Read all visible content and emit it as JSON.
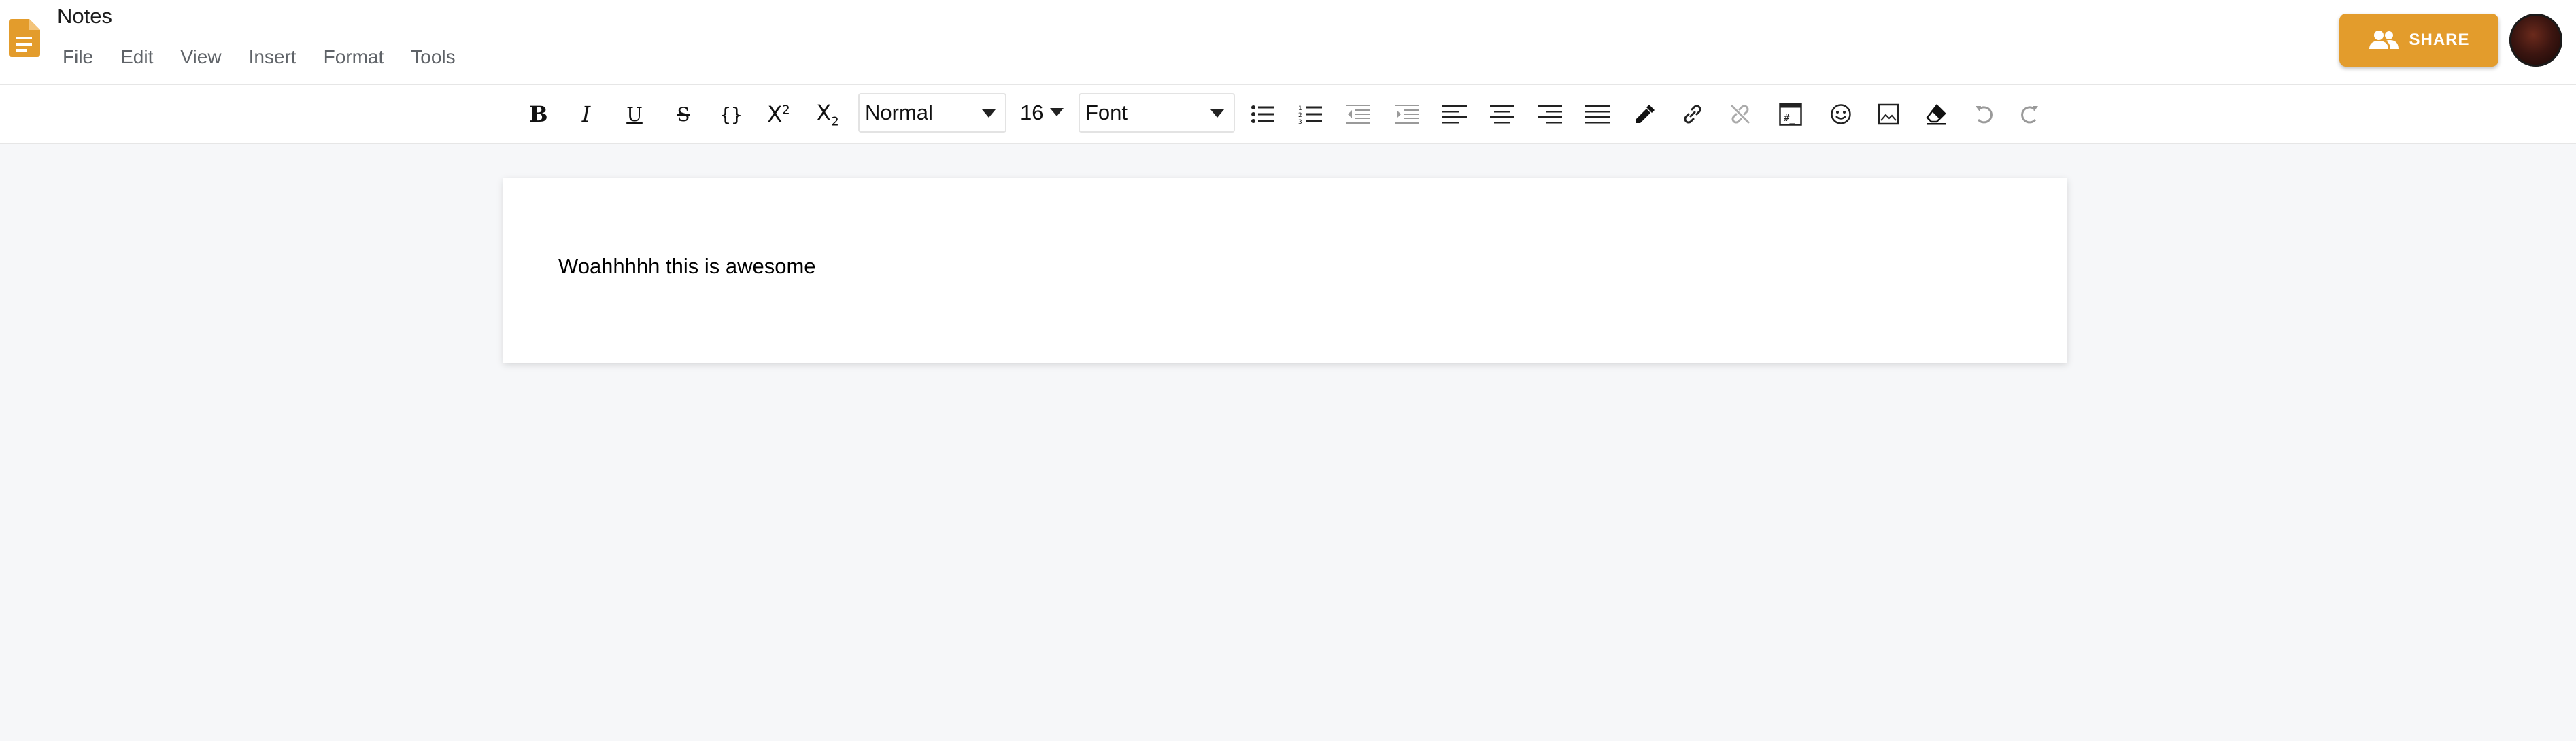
{
  "app": {
    "title": "Notes",
    "icon": "document-icon",
    "accent_color": "#e39c2c"
  },
  "menu": [
    {
      "label": "File"
    },
    {
      "label": "Edit"
    },
    {
      "label": "View"
    },
    {
      "label": "Insert"
    },
    {
      "label": "Format"
    },
    {
      "label": "Tools"
    }
  ],
  "share": {
    "label": "SHARE",
    "icon": "people-icon"
  },
  "toolbar": {
    "style_select": {
      "value": "Normal"
    },
    "size_select": {
      "value": "16"
    },
    "font_select": {
      "value": "Font"
    },
    "buttons": [
      "bold-icon",
      "italic-icon",
      "underline-icon",
      "strikethrough-icon",
      "code-icon",
      "superscript-icon",
      "subscript-icon",
      "bulleted-list-icon",
      "numbered-list-icon",
      "indent-decrease-icon",
      "indent-increase-icon",
      "align-left-icon",
      "align-center-icon",
      "align-right-icon",
      "align-justify-icon",
      "color-picker-icon",
      "link-icon",
      "unlink-icon",
      "code-block-icon",
      "emoji-icon",
      "image-icon",
      "clear-formatting-icon",
      "undo-icon",
      "redo-icon"
    ]
  },
  "document": {
    "content": "Woahhhhh this is awesome"
  }
}
